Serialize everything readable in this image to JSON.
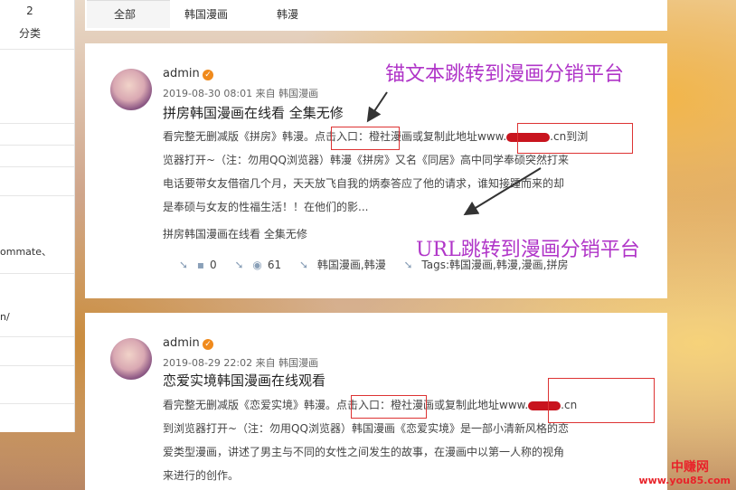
{
  "left_panel": {
    "count": "2",
    "category_label": "分类",
    "fragment_1": "ommate、",
    "fragment_2": "n/"
  },
  "tabs": [
    {
      "label": "全部"
    },
    {
      "label": "韩国漫画"
    },
    {
      "label": "韩漫"
    }
  ],
  "posts": [
    {
      "author": "admin",
      "meta": "2019-08-30 08:01 来自 韩国漫画",
      "title": "拼房韩国漫画在线看 全集无修",
      "lines": [
        "看完整无删减版《拼房》韩漫。点击入口：橙社漫画或复制此地址www.",
        ".cn到浏",
        "览器打开~（注：勿用QQ浏览器）韩漫《拼房》又名《同居》高中同学奉硕突然打来",
        "电话要带女友借宿几个月，天天放飞自我的炳泰答应了他的请求，谁知接踵而来的却",
        "是奉硕与女友的性福生活！！在他们的影..."
      ],
      "tagline": "拼房韩国漫画在线看 全集无修",
      "stats": {
        "comments": "0",
        "views": "61",
        "category": "韩国漫画,韩漫",
        "tags": "Tags:韩国漫画,韩漫,漫画,拼房"
      }
    },
    {
      "author": "admin",
      "meta": "2019-08-29 22:02 来自 韩国漫画",
      "title": "恋爱实境韩国漫画在线观看",
      "lines": [
        "看完整无删减版《恋爱实境》韩漫。点击入口：橙社漫画或复制此地址www.",
        ".cn",
        "到浏览器打开~（注：勿用QQ浏览器）韩国漫画《恋爱实境》是一部小清新风格的恋",
        "爱类型漫画，讲述了男主与不同的女性之间发生的故事，在漫画中以第一人称的视角",
        "来进行的创作。"
      ]
    }
  ],
  "annotations": {
    "anchor_text": "锚文本跳转到漫画分销平台",
    "url_jump": "URL跳转到漫画分销平台"
  },
  "watermark": {
    "brand": "中赚网",
    "url": "www.you85.com"
  },
  "icons": [
    "verified-icon",
    "comment-icon",
    "views-icon",
    "category-icon",
    "tag-icon",
    "arrow-icon"
  ],
  "colors": {
    "annotation": "#b035c8",
    "highlight_box": "#dd3333",
    "verified": "#f08a1c",
    "mask": "#c8141e"
  }
}
